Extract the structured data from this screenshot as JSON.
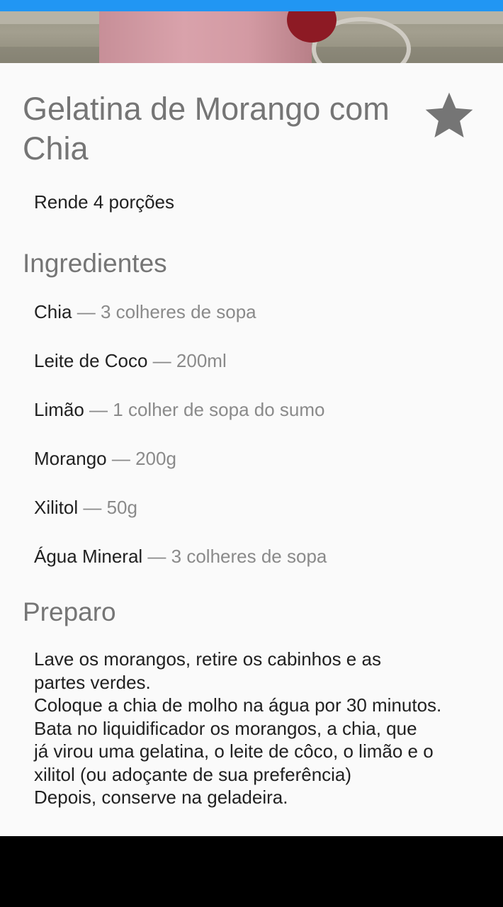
{
  "recipe": {
    "title": "Gelatina de Morango com Chia",
    "servings": "Rende 4 porções"
  },
  "ingredients_section": {
    "heading": "Ingredientes",
    "separator": " — ",
    "items": [
      {
        "name": "Chia",
        "quantity": "3 colheres de sopa"
      },
      {
        "name": "Leite de Coco",
        "quantity": "200ml"
      },
      {
        "name": "Limão",
        "quantity": "1 colher de sopa do sumo"
      },
      {
        "name": "Morango",
        "quantity": "200g"
      },
      {
        "name": "Xilitol",
        "quantity": "50g"
      },
      {
        "name": "Água Mineral",
        "quantity": "3 colheres de sopa"
      }
    ]
  },
  "preparation_section": {
    "heading": "Preparo",
    "lines": [
      "Lave os morangos, retire os cabinhos e as",
      "partes verdes.",
      "Coloque a chia de molho na água por 30 minutos.",
      "Bata no liquidificador os morangos, a chia, que",
      "já virou uma gelatina, o leite de côco, o limão e o",
      "xilitol (ou adoçante de sua preferência)",
      "Depois, conserve na geladeira."
    ]
  },
  "icons": {
    "favorite": "star-icon"
  },
  "colors": {
    "status_bar": "#2196f3",
    "title": "#757575",
    "body_text": "#212121",
    "secondary_text": "#8a8a8a",
    "star": "#757575",
    "background": "#fafafa"
  }
}
